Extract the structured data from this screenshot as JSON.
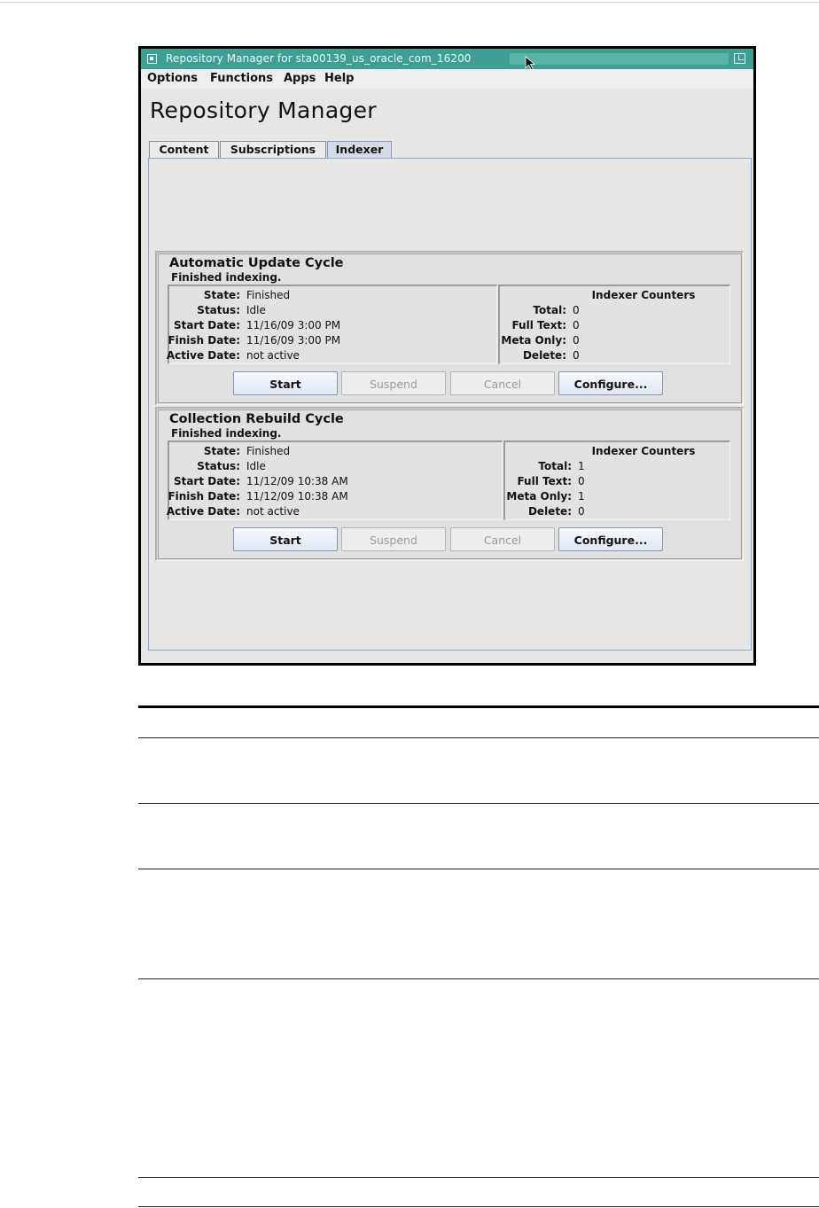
{
  "window": {
    "title": "Repository Manager for sta00139_us_oracle_com_16200"
  },
  "menu": [
    "Options",
    "Functions",
    "Apps",
    "Help"
  ],
  "app": {
    "heading": "Repository Manager",
    "tabs": [
      {
        "label": "Content",
        "active": false
      },
      {
        "label": "Subscriptions",
        "active": false
      },
      {
        "label": "Indexer",
        "active": true
      }
    ]
  },
  "labels": {
    "state": "State:",
    "status": "Status:",
    "start_date": "Start Date:",
    "finish_date": "Finish Date:",
    "active_date": "Active Date:",
    "counters_title": "Indexer Counters",
    "total": "Total:",
    "full_text": "Full Text:",
    "meta_only": "Meta Only:",
    "delete": "Delete:"
  },
  "buttons": {
    "start": "Start",
    "suspend": "Suspend",
    "cancel": "Cancel",
    "configure": "Configure..."
  },
  "cycles": [
    {
      "title": "Automatic Update Cycle",
      "message": "Finished indexing.",
      "state": "Finished",
      "status": "Idle",
      "start_date": "11/16/09 3:00 PM",
      "finish_date": "11/16/09 3:00 PM",
      "active_date": "not active",
      "counters": {
        "total": "0",
        "full_text": "0",
        "meta_only": "0",
        "delete": "0"
      }
    },
    {
      "title": "Collection Rebuild Cycle",
      "message": "Finished indexing.",
      "state": "Finished",
      "status": "Idle",
      "start_date": "11/12/09 10:38 AM",
      "finish_date": "11/12/09 10:38 AM",
      "active_date": "not active",
      "counters": {
        "total": "1",
        "full_text": "0",
        "meta_only": "1",
        "delete": "0"
      }
    }
  ],
  "colors": {
    "titlebar": "#3f9f94",
    "active_tab": "#d4dbe7",
    "button_border": "#7f98bb"
  }
}
